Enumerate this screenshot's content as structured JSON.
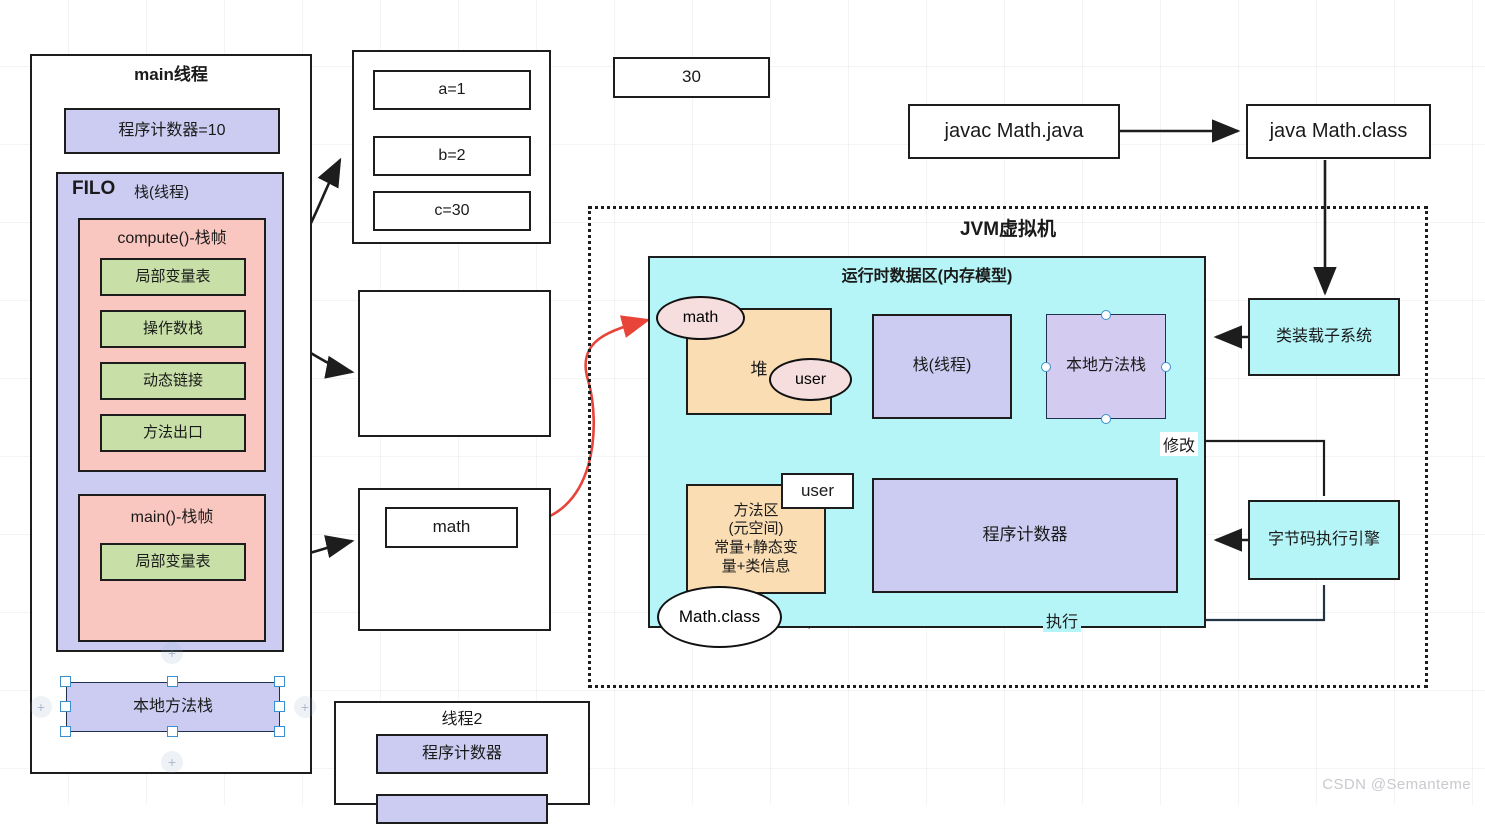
{
  "canvas": {
    "watermark": "CSDN @Semanteme"
  },
  "main_thread": {
    "title": "main线程",
    "pc": "程序计数器=10",
    "stack": {
      "filo": "FILO",
      "label": "栈(线程)"
    },
    "compute_frame": {
      "title": "compute()-栈帧",
      "slots": [
        "局部变量表",
        "操作数栈",
        "动态链接",
        "方法出口"
      ]
    },
    "main_frame": {
      "title": "main()-栈帧",
      "slots": [
        "局部变量表"
      ]
    },
    "native_stack": "本地方法栈"
  },
  "locals_box": {
    "rows": [
      "a=1",
      "b=2",
      "c=30"
    ]
  },
  "operand_box": {
    "text": ""
  },
  "math_ref_box": {
    "text": "math"
  },
  "result_box": {
    "text": "30"
  },
  "thread2": {
    "title": "线程2",
    "pc": "程序计数器"
  },
  "compile_flow": {
    "javac": "javac Math.java",
    "java": "java Math.class"
  },
  "jvm": {
    "title": "JVM虚拟机",
    "runtime_area": {
      "title": "运行时数据区(内存模型)",
      "heap": {
        "label": "堆",
        "objects": [
          "math",
          "user"
        ]
      },
      "method_area": {
        "label": "方法区\n(元空间)\n常量+静态变\n量+类信息"
      },
      "vm_stack": "栈(线程)",
      "native_method_stack": "本地方法栈",
      "pc_register": "程序计数器",
      "class_ellipse": "Math.class",
      "user_callout": "user"
    },
    "class_loader": "类装载子系统",
    "execution_engine": "字节码执行引擎",
    "edge_labels": {
      "modify": "修改",
      "execute": "执行"
    }
  },
  "colors": {
    "purple_fill": "#ccccf2",
    "pink_fill": "#fac7c0",
    "green_fill": "#c8e0a8",
    "cyan_fill": "#b5f4f7",
    "heap_fill": "#fbddb4",
    "obj_fill": "#f6dede",
    "border": "#1d1d1d",
    "accent_red": "#e8443a",
    "selection": "#3a8fd0"
  }
}
